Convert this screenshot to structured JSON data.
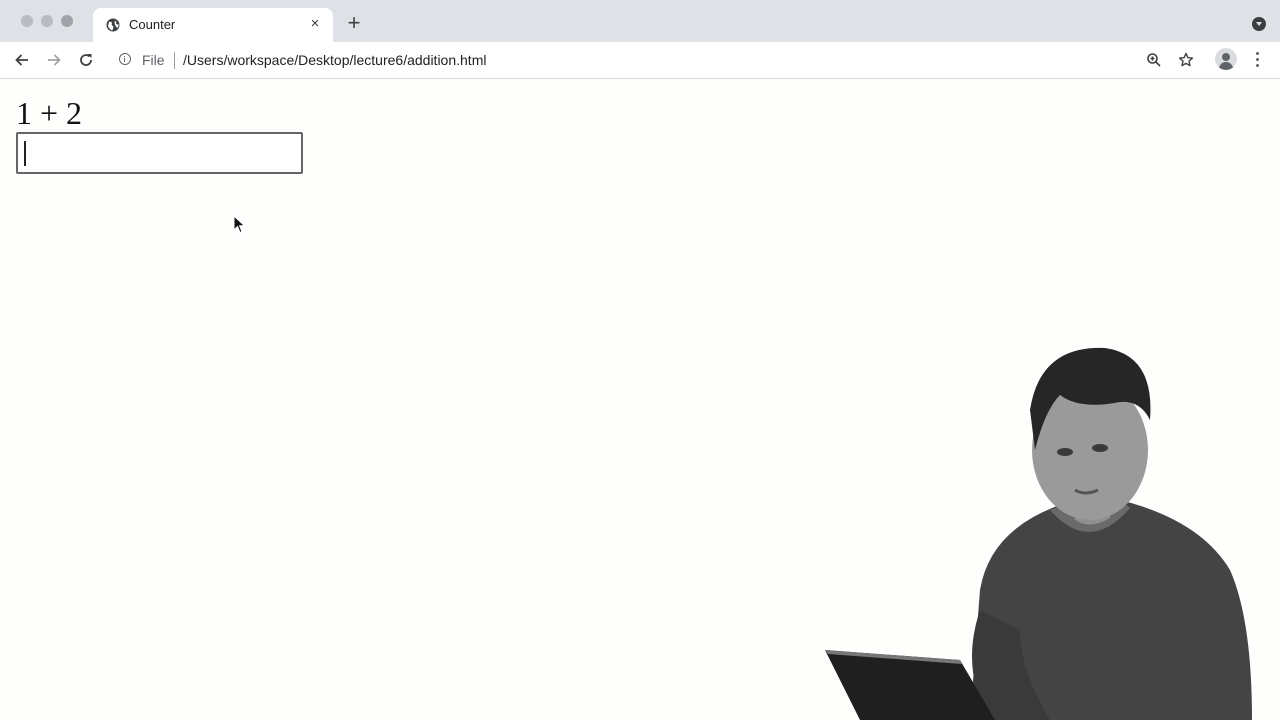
{
  "browser": {
    "tab": {
      "title": "Counter",
      "favicon": "globe-icon",
      "close": "×"
    },
    "new_tab": "+",
    "address": {
      "scheme_label": "File",
      "url": "/Users/workspace/Desktop/lecture6/addition.html"
    }
  },
  "page": {
    "question": "1 + 2",
    "answer_value": ""
  },
  "colors": {
    "tabstrip": "#dee1e6",
    "toolbar": "#ffffff",
    "page_bg": "#fefefd"
  }
}
